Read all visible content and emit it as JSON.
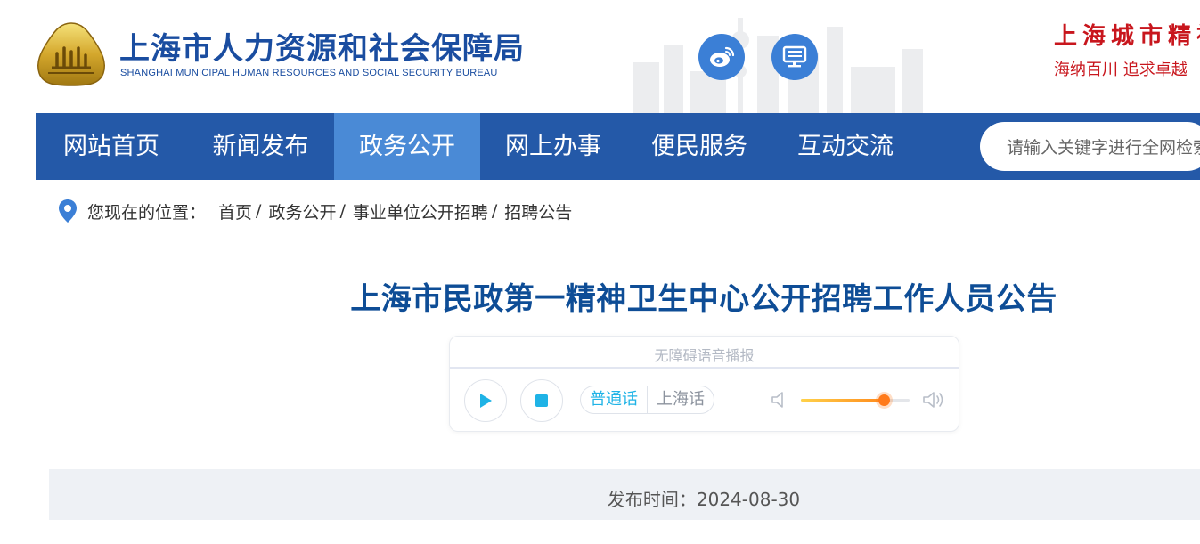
{
  "header": {
    "site_name_cn": "上海市人力资源和社会保障局",
    "site_name_en": "SHANGHAI MUNICIPAL HUMAN RESOURCES AND SOCIAL SECURITY BUREAU",
    "slogan_line1": "上海城市精神",
    "slogan_line2": "海纳百川 追求卓越",
    "icons": [
      "weibo-icon",
      "desktop-icon"
    ],
    "accent_color": "#2459a8",
    "slogan_color": "#c8161d"
  },
  "nav": {
    "items": [
      {
        "label": "网站首页"
      },
      {
        "label": "新闻发布"
      },
      {
        "label": "政务公开",
        "active": true
      },
      {
        "label": "网上办事"
      },
      {
        "label": "便民服务"
      },
      {
        "label": "互动交流"
      }
    ],
    "active_color": "#4a8ad6"
  },
  "search": {
    "placeholder": "请输入关键字进行全网检索"
  },
  "breadcrumb": {
    "prefix": "您现在的位置：",
    "items": [
      "首页",
      "政务公开",
      "事业单位公开招聘",
      "招聘公告"
    ],
    "separator": "/"
  },
  "article": {
    "title": "上海市民政第一精神卫生中心公开招聘工作人员公告",
    "publish_label": "发布时间：2024-08-30"
  },
  "audio_player": {
    "title": "无障碍语音播报",
    "languages": [
      "普通话",
      "上海话"
    ],
    "selected_language": "普通话",
    "volume_level": 0.76
  }
}
